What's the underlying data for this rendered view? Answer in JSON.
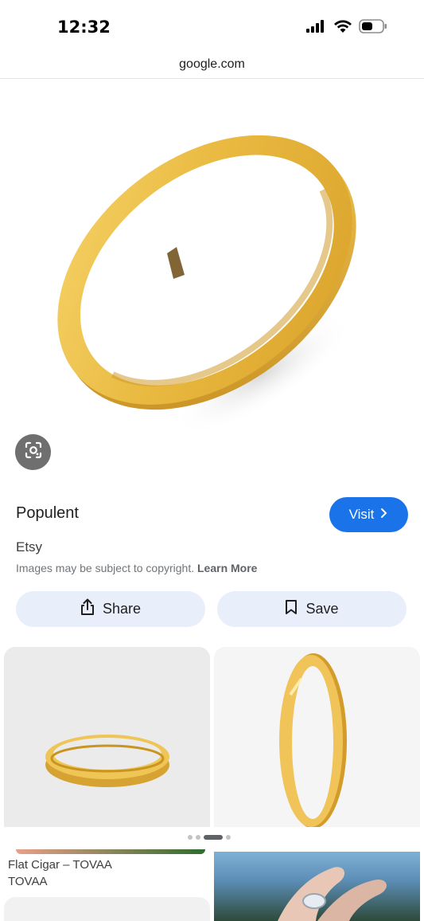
{
  "status": {
    "time": "12:32",
    "icons": [
      "signal-icon",
      "wifi-icon",
      "battery-icon"
    ]
  },
  "browser": {
    "url": "google.com"
  },
  "result": {
    "title": "Populent",
    "source": "Etsy",
    "visit_label": "Visit",
    "copyright_text": "Images may be subject to copyright.",
    "learn_more": "Learn More"
  },
  "actions": {
    "share_label": "Share",
    "save_label": "Save"
  },
  "related": [
    {
      "title": "Flat Cigar – TOVAA",
      "source": "TOVAA"
    }
  ],
  "colors": {
    "accent": "#1a73e8",
    "action_bg": "#e8eefa",
    "gold": "#e9b940"
  }
}
